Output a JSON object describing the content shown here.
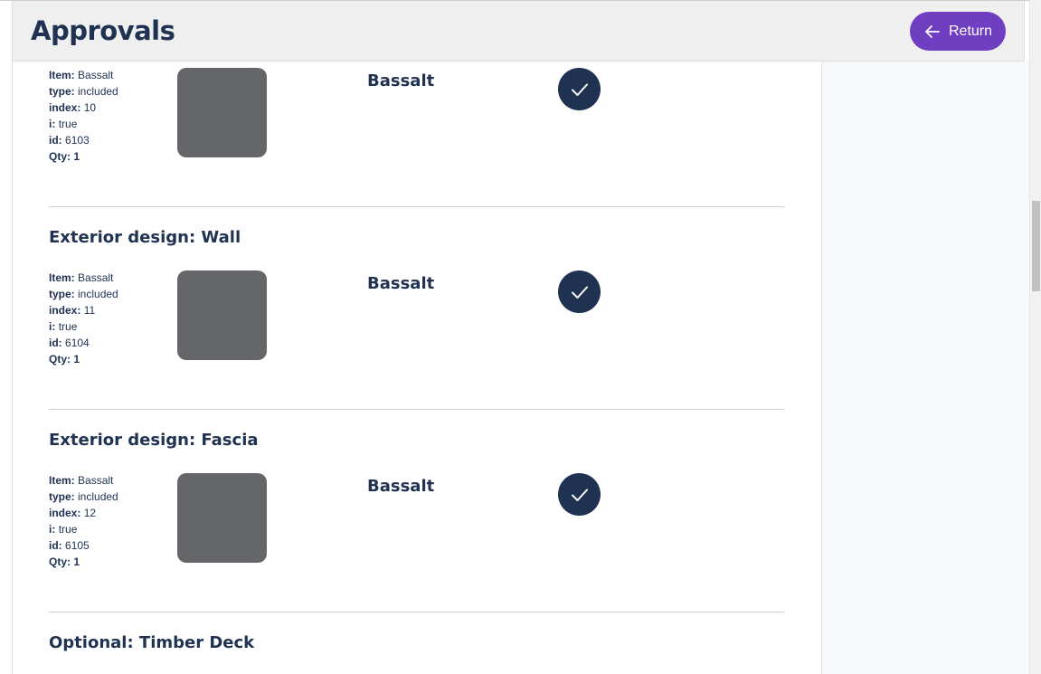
{
  "header": {
    "title": "Approvals",
    "return_label": "Return"
  },
  "sections": [
    {
      "title": "",
      "item_label": "Item:",
      "item_value": "Bassalt",
      "type_label": "type:",
      "type_value": "included",
      "index_label": "index:",
      "index_value": "10",
      "i_label": "i:",
      "i_value": "true",
      "id_label": "id:",
      "id_value": "6103",
      "qty_label": "Qty: 1",
      "name": "Bassalt",
      "approved": true
    },
    {
      "title": "Exterior design: Wall",
      "item_label": "Item:",
      "item_value": "Bassalt",
      "type_label": "type:",
      "type_value": "included",
      "index_label": "index:",
      "index_value": "11",
      "i_label": "i:",
      "i_value": "true",
      "id_label": "id:",
      "id_value": "6104",
      "qty_label": "Qty: 1",
      "name": "Bassalt",
      "approved": true
    },
    {
      "title": "Exterior design: Fascia",
      "item_label": "Item:",
      "item_value": "Bassalt",
      "type_label": "type:",
      "type_value": "included",
      "index_label": "index:",
      "index_value": "12",
      "i_label": "i:",
      "i_value": "true",
      "id_label": "id:",
      "id_value": "6105",
      "qty_label": "Qty: 1",
      "name": "Bassalt",
      "approved": true
    },
    {
      "title": "Optional: Timber Deck"
    }
  ],
  "icons": {
    "return": "arrow-left-icon",
    "approved": "check-icon"
  },
  "colors": {
    "primary_text": "#1f3251",
    "accent": "#6f3ec1",
    "check_bg": "#1f3251",
    "thumbnail": "#65666a"
  }
}
